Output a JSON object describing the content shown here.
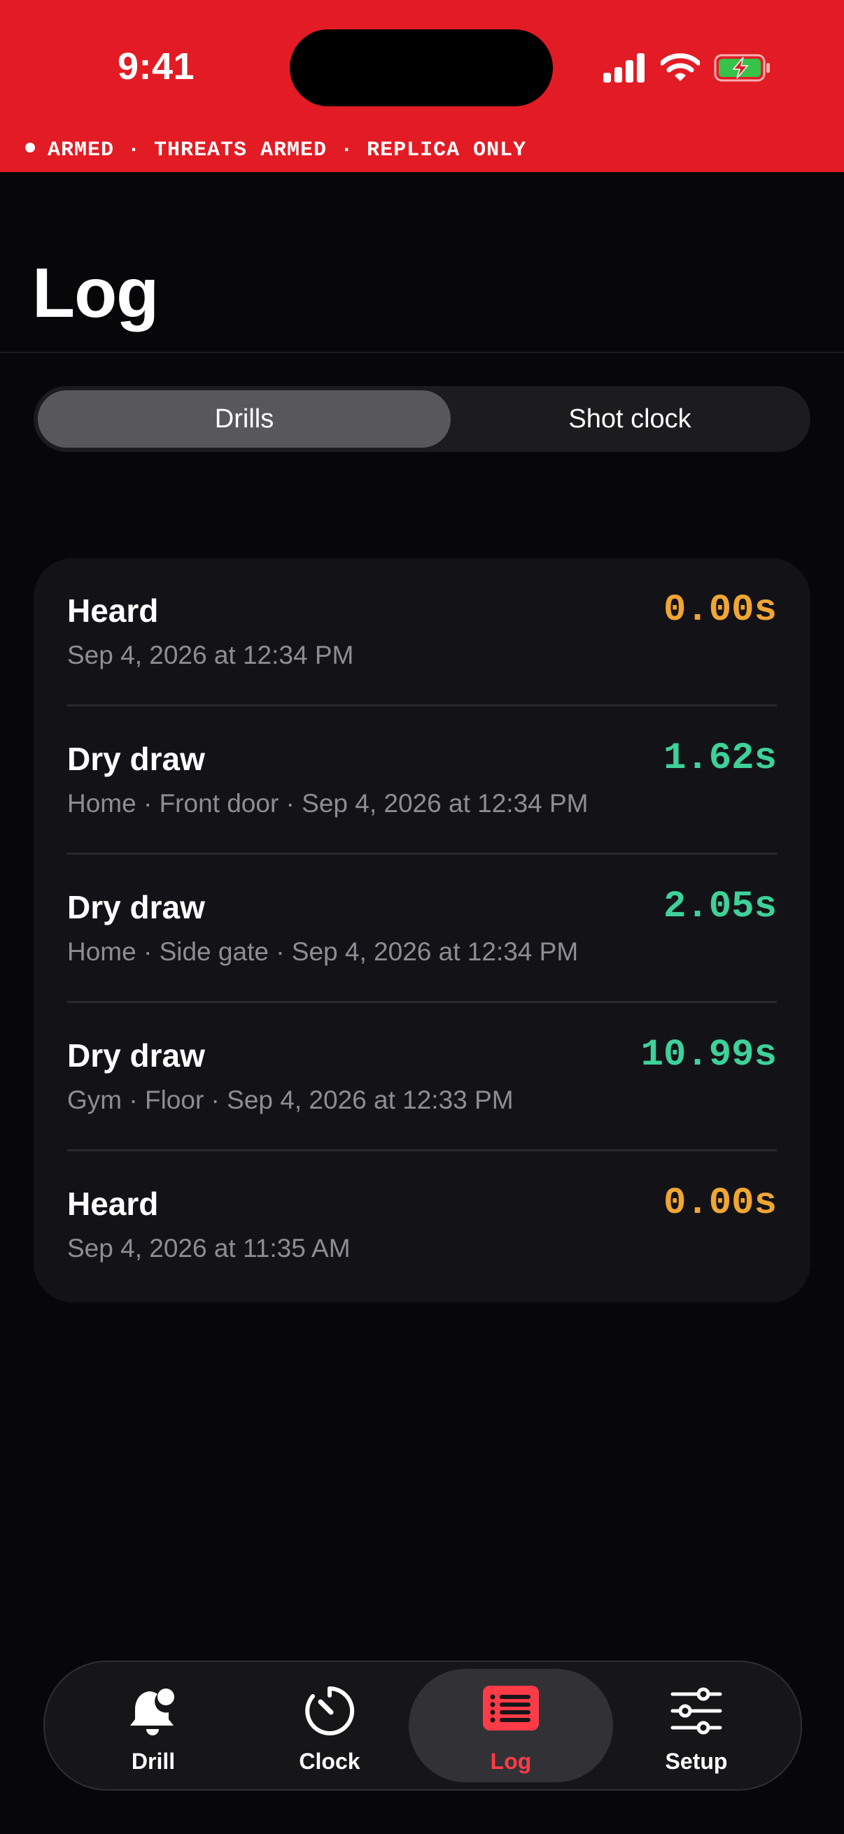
{
  "status_bar": {
    "time": "9:41",
    "armed_text": "ARMED · THREATS ARMED · REPLICA ONLY",
    "banner_color": "#e31b24",
    "icons": [
      "cellular-signal-icon",
      "wifi-icon",
      "battery-charging-icon"
    ]
  },
  "header": {
    "title": "Log"
  },
  "segmented": {
    "drills": "Drills",
    "shot_clock": "Shot clock",
    "selected": "Drills"
  },
  "log": [
    {
      "title": "Heard",
      "subtitle": "Sep 4, 2026 at 12:34 PM",
      "time": "0.00s",
      "color": "#f1a533"
    },
    {
      "title": "Dry draw",
      "subtitle": "Home · Front door · Sep 4, 2026 at 12:34 PM",
      "time": "1.62s",
      "color": "#3ed19a"
    },
    {
      "title": "Dry draw",
      "subtitle": "Home · Side gate · Sep 4, 2026 at 12:34 PM",
      "time": "2.05s",
      "color": "#3ed19a"
    },
    {
      "title": "Dry draw",
      "subtitle": "Gym · Floor · Sep 4, 2026 at 12:33 PM",
      "time": "10.99s",
      "color": "#3ed19a"
    },
    {
      "title": "Heard",
      "subtitle": "Sep 4, 2026 at 11:35 AM",
      "time": "0.00s",
      "color": "#f1a533"
    }
  ],
  "tabs": [
    {
      "label": "Drill",
      "icon": "bell-icon"
    },
    {
      "label": "Clock",
      "icon": "timer-icon"
    },
    {
      "label": "Log",
      "icon": "list-icon",
      "active": true,
      "color": "#ff3b47"
    },
    {
      "label": "Setup",
      "icon": "sliders-icon"
    }
  ]
}
